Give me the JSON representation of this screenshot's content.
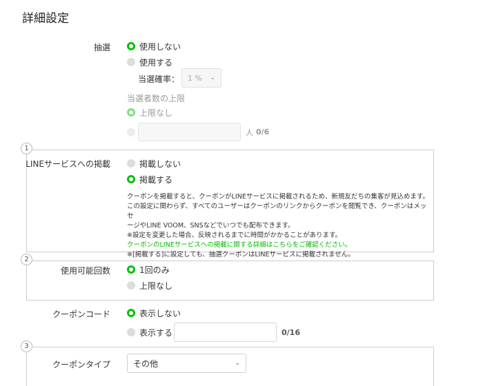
{
  "page_title": "詳細設定",
  "lottery": {
    "label": "抽選",
    "option_off": "使用しない",
    "option_on": "使用する",
    "rate_label": "当選確率：",
    "rate_value": "1 %",
    "winners_limit_label": "当選者数の上限",
    "limit_none": "上限なし",
    "limit_unit": "人",
    "limit_counter": "0/6"
  },
  "line_service": {
    "step": "1",
    "label": "LINEサービスへの掲載",
    "option_off": "掲載しない",
    "option_on": "掲載する",
    "desc_1": "クーポンを掲載すると、クーポンがLINEサービスに掲載されるため、新規友だちの集客が見込めます。",
    "desc_2": "この設定に関わらず、すべてのユーザーはクーポンのリンクからクーポンを閲覧でき、クーポンはメッセ",
    "desc_3": "ージやLINE VOOM、SNSなどでいつでも配布できます。",
    "desc_4": "※設定を変更した場合、反映されるまでに時間がかかることがあります。",
    "link": "クーポンのLINEサービスへの掲載に関する詳細はこちらをご確認ください。",
    "desc_5": "※[掲載する]に設定しても、抽選クーポンはLINEサービスに掲載されません。"
  },
  "usage": {
    "step": "2",
    "label": "使用可能回数",
    "option_once": "1回のみ",
    "option_unlimited": "上限なし"
  },
  "coupon_code": {
    "label": "クーポンコード",
    "option_hide": "表示しない",
    "option_show": "表示する",
    "counter": "0/16"
  },
  "coupon_type": {
    "step": "3",
    "label": "クーポンタイプ",
    "value": "その他"
  },
  "colors": {
    "accent": "#00c300"
  }
}
